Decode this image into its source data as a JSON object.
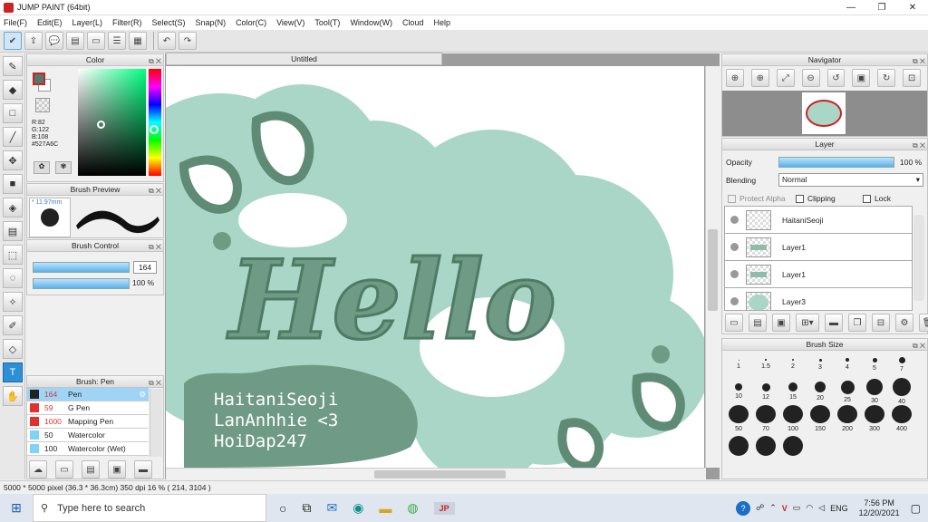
{
  "app": {
    "title": "JUMP PAINT (64bit)",
    "min": "—",
    "max": "❐",
    "close": "✕"
  },
  "menu": [
    "File(F)",
    "Edit(E)",
    "Layer(L)",
    "Filter(R)",
    "Select(S)",
    "Snap(N)",
    "Color(C)",
    "View(V)",
    "Tool(T)",
    "Window(W)",
    "Cloud",
    "Help"
  ],
  "panels": {
    "color": {
      "title": "Color",
      "r": "R:82",
      "g": "G:122",
      "b": "B:108",
      "hex": "#527A6C",
      "main_color": "#527A6C"
    },
    "brush_preview": {
      "title": "Brush Preview",
      "size": "11.97mm"
    },
    "brush_control": {
      "title": "Brush Control",
      "size": "164",
      "opacity": "100 %"
    },
    "brushes": {
      "title": "Brush: Pen",
      "items": [
        {
          "size": "164",
          "name": "Pen",
          "color": "#222222",
          "selected": true
        },
        {
          "size": "59",
          "name": "G Pen",
          "color": "#e03030",
          "selected": false
        },
        {
          "size": "1000",
          "name": "Mapping Pen",
          "color": "#e03030",
          "selected": false
        },
        {
          "size": "50",
          "name": "Watercolor",
          "color": "#7fd3f5",
          "selected": false
        },
        {
          "size": "100",
          "name": "Watercolor (Wet)",
          "color": "#7fd3f5",
          "selected": false
        }
      ]
    },
    "navigator": {
      "title": "Navigator"
    },
    "layer": {
      "title": "Layer",
      "opacity_label": "Opacity",
      "opacity_value": "100 %",
      "blending_label": "Blending",
      "blending_value": "Normal",
      "protect_alpha": "Protect Alpha",
      "clipping": "Clipping",
      "lock": "Lock",
      "layers": [
        "HaitaniSeoji",
        "Layer1",
        "Layer1",
        "Layer3"
      ]
    },
    "brush_size": {
      "title": "Brush Size",
      "sizes": [
        "1",
        "1.5",
        "2",
        "3",
        "4",
        "5",
        "7",
        "10",
        "12",
        "15",
        "20",
        "25",
        "30",
        "40",
        "50",
        "70",
        "100",
        "150",
        "200",
        "300",
        "400",
        "",
        "",
        ""
      ]
    }
  },
  "document": {
    "tab": "Untitled",
    "hello": "Hello",
    "credit_lines": [
      "HaitaniSeoji",
      "LanAnhhie  <3",
      "HoiDap247"
    ]
  },
  "status": {
    "text": "5000 * 5000 pixel   (36.3 * 36.3cm)   350 dpi   16 %   ( 214, 3104 )"
  },
  "taskbar": {
    "search_placeholder": "Type here to search",
    "time": "7:56 PM",
    "date": "12/20/2021",
    "lang": "ENG"
  },
  "colors": {
    "mint": "#a9d6c6",
    "dark_green": "#6f9a86",
    "accent": "#2d8fd6"
  }
}
